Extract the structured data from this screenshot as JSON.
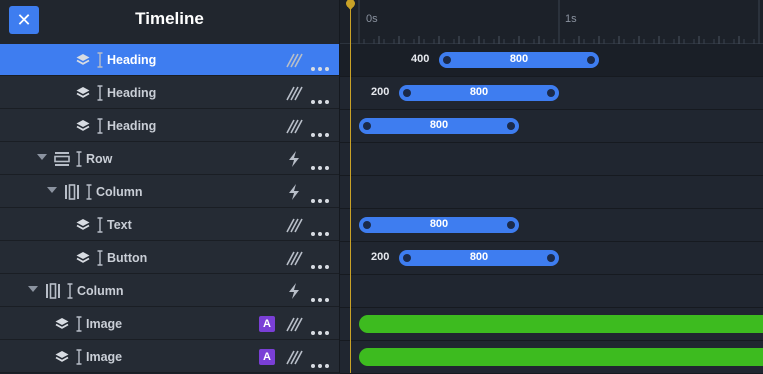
{
  "header": {
    "title": "Timeline",
    "close_glyph": "✕"
  },
  "ruler": {
    "ticks": [
      "0s",
      "1s"
    ]
  },
  "colors": {
    "accent": "#3e7df0",
    "green": "#3dbb1f",
    "badge": "#7a3fd6",
    "playhead": "#c9a227"
  },
  "layers": [
    {
      "label": "Heading",
      "icon": "layers-icon",
      "selected": true,
      "ease": "ease-curve-icon",
      "anim": {
        "delay": "400",
        "duration": "800"
      }
    },
    {
      "label": "Heading",
      "icon": "layers-icon",
      "ease": "ease-curve-icon",
      "anim": {
        "delay": "200",
        "duration": "800"
      }
    },
    {
      "label": "Heading",
      "icon": "layers-icon",
      "ease": "ease-curve-icon",
      "anim": {
        "delay": "",
        "duration": "800"
      }
    },
    {
      "label": "Row",
      "icon": "row-icon",
      "collapsible": true,
      "ease": "lightning-icon"
    },
    {
      "label": "Column",
      "icon": "column-icon",
      "collapsible": true,
      "ease": "lightning-icon"
    },
    {
      "label": "Text",
      "icon": "layers-icon",
      "ease": "ease-curve-icon",
      "anim": {
        "delay": "",
        "duration": "800"
      }
    },
    {
      "label": "Button",
      "icon": "layers-icon",
      "ease": "ease-curve-icon",
      "anim": {
        "delay": "200",
        "duration": "800"
      }
    },
    {
      "label": "Column",
      "icon": "column-icon",
      "collapsible": true,
      "ease": "lightning-icon"
    },
    {
      "label": "Image",
      "icon": "layers-icon",
      "badge": "A",
      "ease": "ease-curve-icon",
      "green": true
    },
    {
      "label": "Image",
      "icon": "layers-icon",
      "badge": "A",
      "ease": "ease-curve-icon",
      "green": true
    }
  ]
}
